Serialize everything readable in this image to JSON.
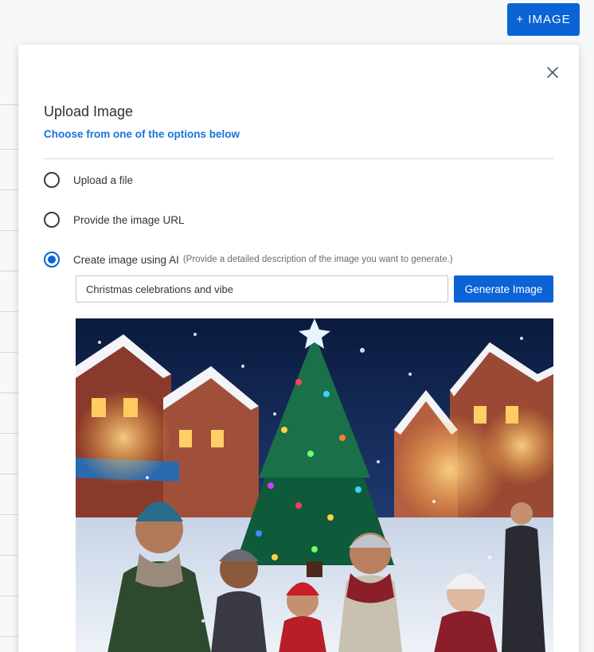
{
  "header": {
    "add_image_label": "+ IMAGE"
  },
  "modal": {
    "title": "Upload Image",
    "subtitle": "Choose from one of the options below",
    "options": [
      {
        "label": "Upload a file",
        "selected": false
      },
      {
        "label": "Provide the image URL",
        "selected": false
      },
      {
        "label": "Create image using AI",
        "hint": "(Provide a detailed description of the image you want to generate.)",
        "selected": true
      }
    ],
    "ai": {
      "prompt_value": "Christmas celebrations and vibe",
      "generate_label": "Generate Image"
    }
  },
  "colors": {
    "primary": "#0b63d6",
    "subtitle_blue": "#1a73d9"
  },
  "icons": {
    "close": "close-icon"
  }
}
